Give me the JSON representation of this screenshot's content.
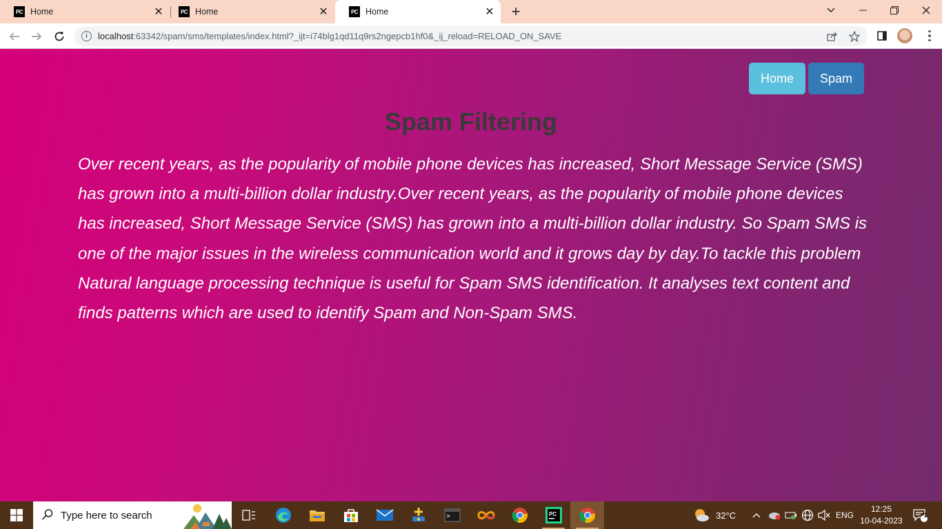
{
  "browser": {
    "tabs": [
      {
        "title": "Home",
        "favicon": "PC",
        "active": false
      },
      {
        "title": "Home",
        "favicon": "PC",
        "active": false
      },
      {
        "title": "Home",
        "favicon": "PC",
        "active": true
      }
    ],
    "url_host": "localhost",
    "url_rest": ":63342/spam/sms/templates/index.html?_ijt=i74blg1qd11q9rs2ngepcb1hf0&_ij_reload=RELOAD_ON_SAVE"
  },
  "nav": {
    "home_label": "Home",
    "spam_label": "Spam"
  },
  "main": {
    "title": "Spam Filtering",
    "paragraph": "Over recent years, as the popularity of mobile phone devices has increased, Short Message Service (SMS) has grown into a multi-billion dollar industry.Over recent years, as the popularity of mobile phone devices has increased, Short Message Service (SMS) has grown into a multi-billion dollar industry. So Spam SMS is one of the major issues in the wireless communication world and it grows day by day.To tackle this problem Natural language processing technique is useful for Spam SMS identification. It analyses text content and finds patterns which are used to identify Spam and Non-Spam SMS."
  },
  "taskbar": {
    "search_placeholder": "Type here to search",
    "temperature": "32°C",
    "language": "ENG",
    "time": "12:25",
    "date": "10-04-2023",
    "notification_count": "1"
  },
  "colors": {
    "home_button": "#5bc0de",
    "spam_button": "#337ab7",
    "page_gradient_start": "#d5007b",
    "page_gradient_end": "#722b6c",
    "title_text": "#3a3a3a",
    "tabstrip": "#f9d6c6",
    "taskbar": "#4e3019"
  }
}
